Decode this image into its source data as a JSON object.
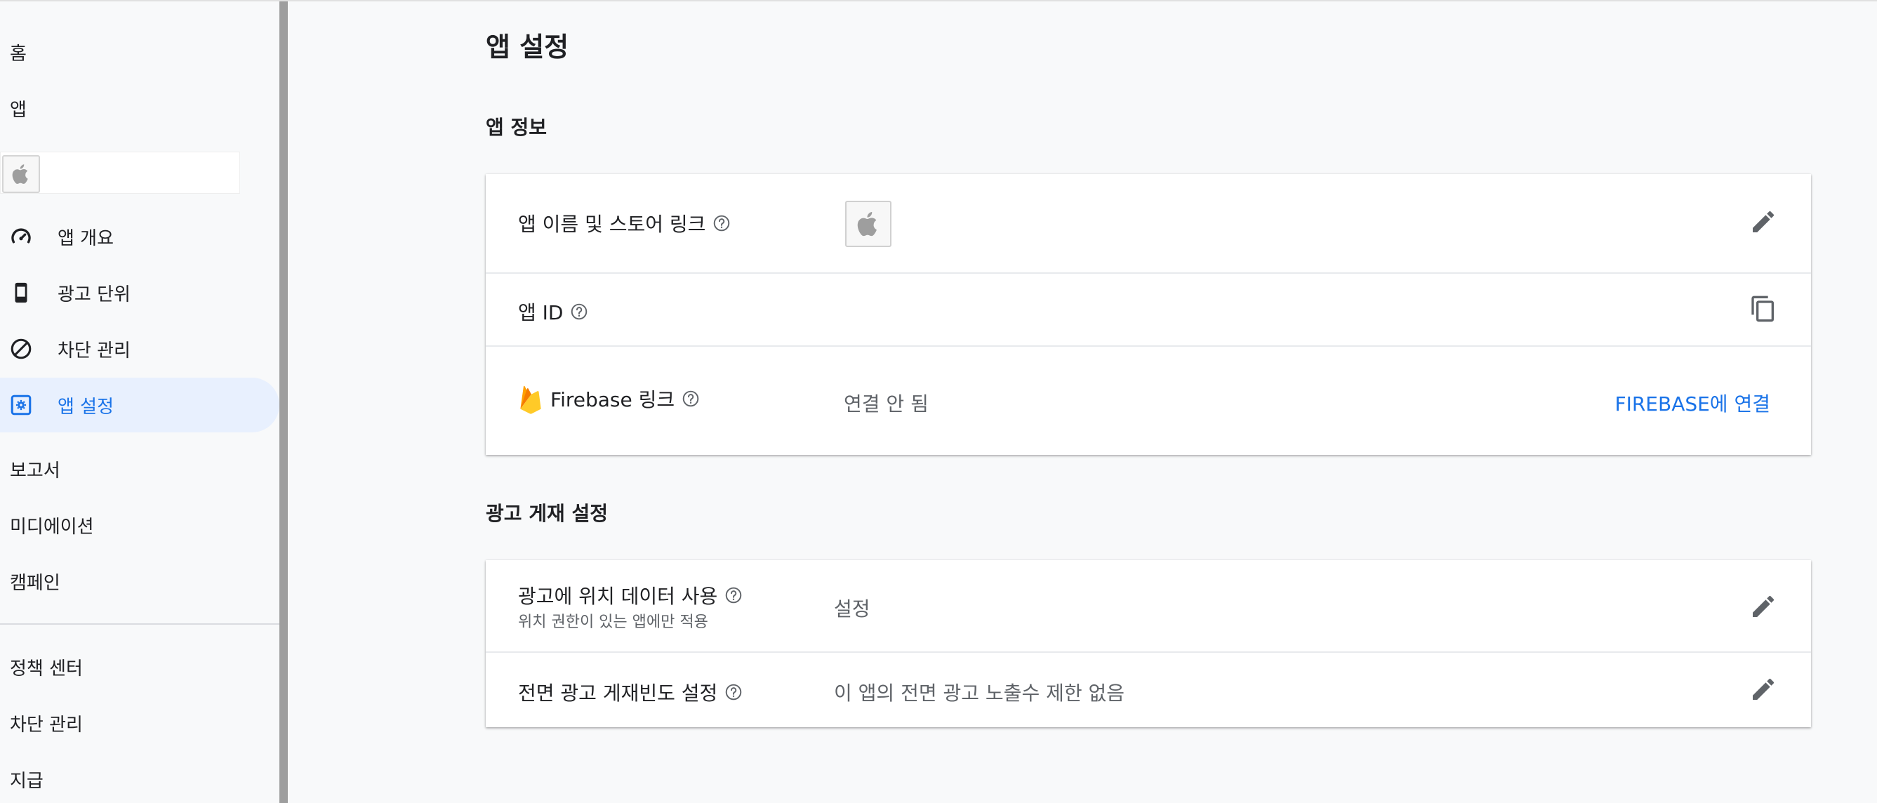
{
  "sidebar": {
    "home_label": "홈",
    "apps_label": "앱",
    "app_items": [
      {
        "label": "앱 개요",
        "icon": "gauge-icon"
      },
      {
        "label": "광고 단위",
        "icon": "phone-icon"
      },
      {
        "label": "차단 관리",
        "icon": "block-icon"
      },
      {
        "label": "앱 설정",
        "icon": "app-settings-icon",
        "active": true
      }
    ],
    "reports_label": "보고서",
    "mediation_label": "미디에이션",
    "campaigns_label": "캠페인",
    "policy_label": "정책 센터",
    "blocking_label": "차단 관리",
    "payments_label": "지급"
  },
  "main": {
    "page_title": "앱 설정",
    "app_info": {
      "section_title": "앱 정보",
      "name_store_label": "앱 이름 및 스토어 링크",
      "app_id_label": "앱 ID",
      "firebase_label": "Firebase 링크",
      "firebase_status": "연결 안 됨",
      "firebase_action": "FIREBASE에 연결"
    },
    "ad_serving": {
      "section_title": "광고 게재 설정",
      "location_label": "광고에 위치 데이터 사용",
      "location_sub": "위치 권한이 있는 앱에만 적용",
      "location_value": "설정",
      "frequency_label": "전면 광고 게재빈도 설정",
      "frequency_value": "이 앱의 전면 광고 노출수 제한 없음"
    }
  },
  "colors": {
    "accent": "#1a73e8",
    "active_bg": "#e8f0fe",
    "firebase_yellow": "#FFCA28",
    "firebase_orange": "#F57C00"
  }
}
